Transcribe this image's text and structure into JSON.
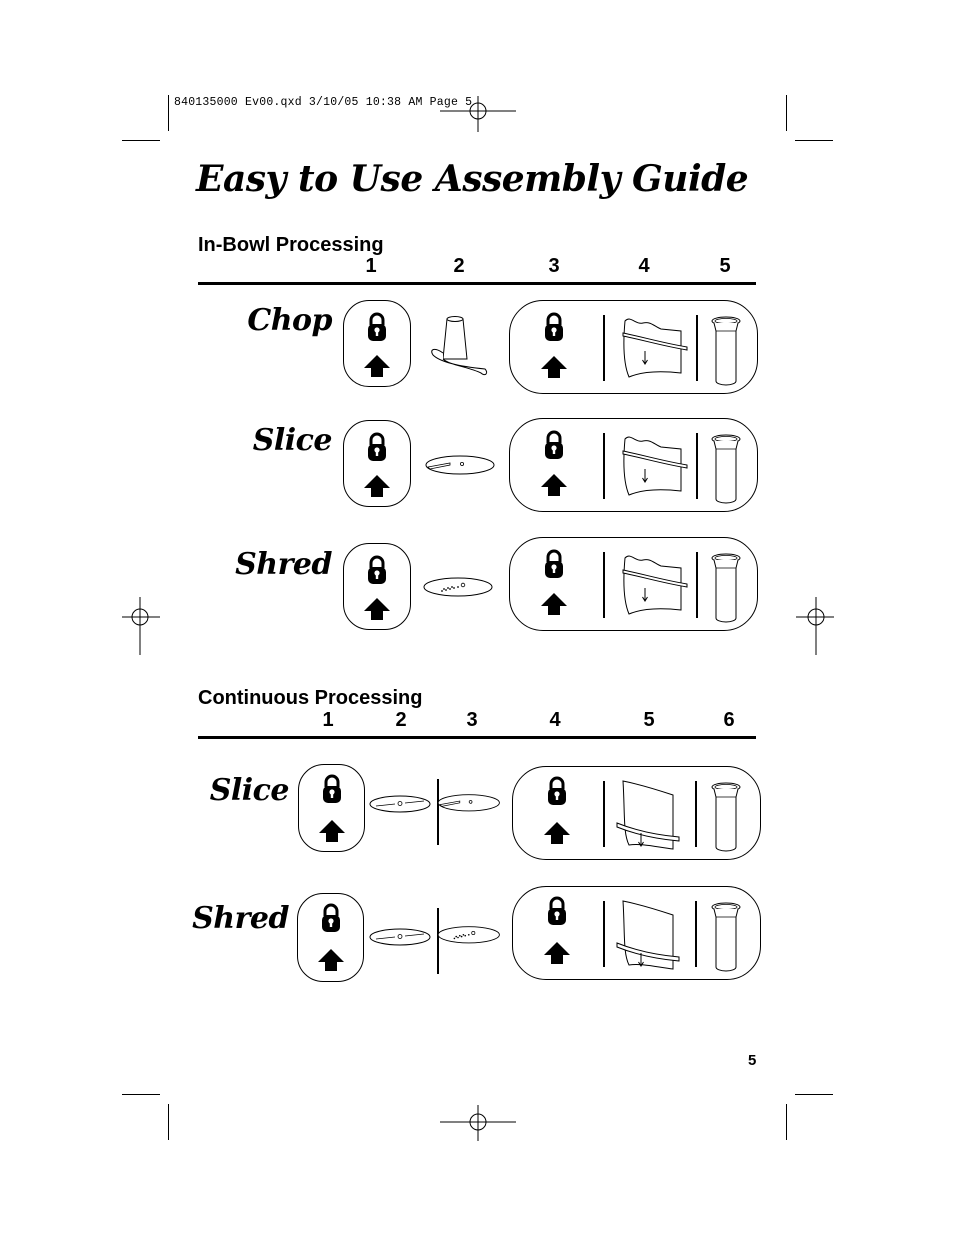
{
  "slug_line": "840135000 Ev00.qxd  3/10/05  10:38 AM  Page 5",
  "title": "Easy to Use Assembly Guide",
  "in_bowl": {
    "heading": "In-Bowl Processing",
    "steps": [
      "1",
      "2",
      "3",
      "4",
      "5"
    ],
    "rows": [
      {
        "label": "Chop",
        "part_icon": "chopping-blade-icon"
      },
      {
        "label": "Slice",
        "part_icon": "slicing-disc-icon"
      },
      {
        "label": "Shred",
        "part_icon": "shredding-disc-icon"
      }
    ]
  },
  "continuous": {
    "heading": "Continuous Processing",
    "steps": [
      "1",
      "2",
      "3",
      "4",
      "5",
      "6"
    ],
    "rows": [
      {
        "label": "Slice",
        "part_icons": [
          "disc-holder-icon",
          "slicing-disc-icon"
        ]
      },
      {
        "label": "Shred",
        "part_icons": [
          "disc-holder-icon",
          "shredding-disc-icon"
        ]
      }
    ]
  },
  "icons": {
    "lock": "lock-icon",
    "arrow": "arrow-up-icon",
    "lid": "lid-icon",
    "pusher": "food-pusher-icon"
  },
  "page_number": "5"
}
